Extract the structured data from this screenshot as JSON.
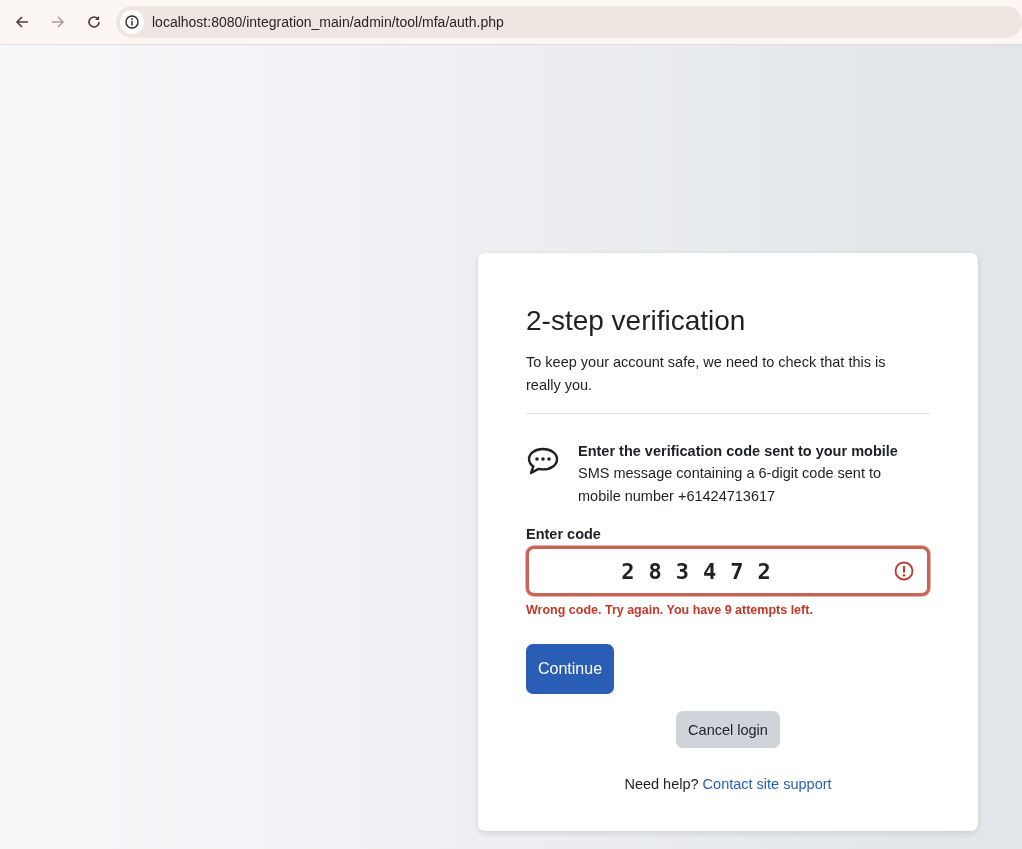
{
  "browser": {
    "url": "localhost:8080/integration_main/admin/tool/mfa/auth.php",
    "forward_disabled": true
  },
  "card": {
    "title": "2-step verification",
    "intro": "To keep your account safe, we need to check that this is really you.",
    "factor": {
      "heading": "Enter the verification code sent to your mobile",
      "description": "SMS message containing a 6-digit code sent to mobile number +61424713617"
    },
    "code_field": {
      "label": "Enter code",
      "value": "283472",
      "invalid": true,
      "error": "Wrong code. Try again. You have 9 attempts left."
    },
    "buttons": [
      {
        "kind": "primary",
        "label": "Continue"
      },
      {
        "kind": "secondary",
        "label": "Cancel login"
      }
    ],
    "help": {
      "text": "Need help?",
      "link": "Contact site support"
    }
  }
}
